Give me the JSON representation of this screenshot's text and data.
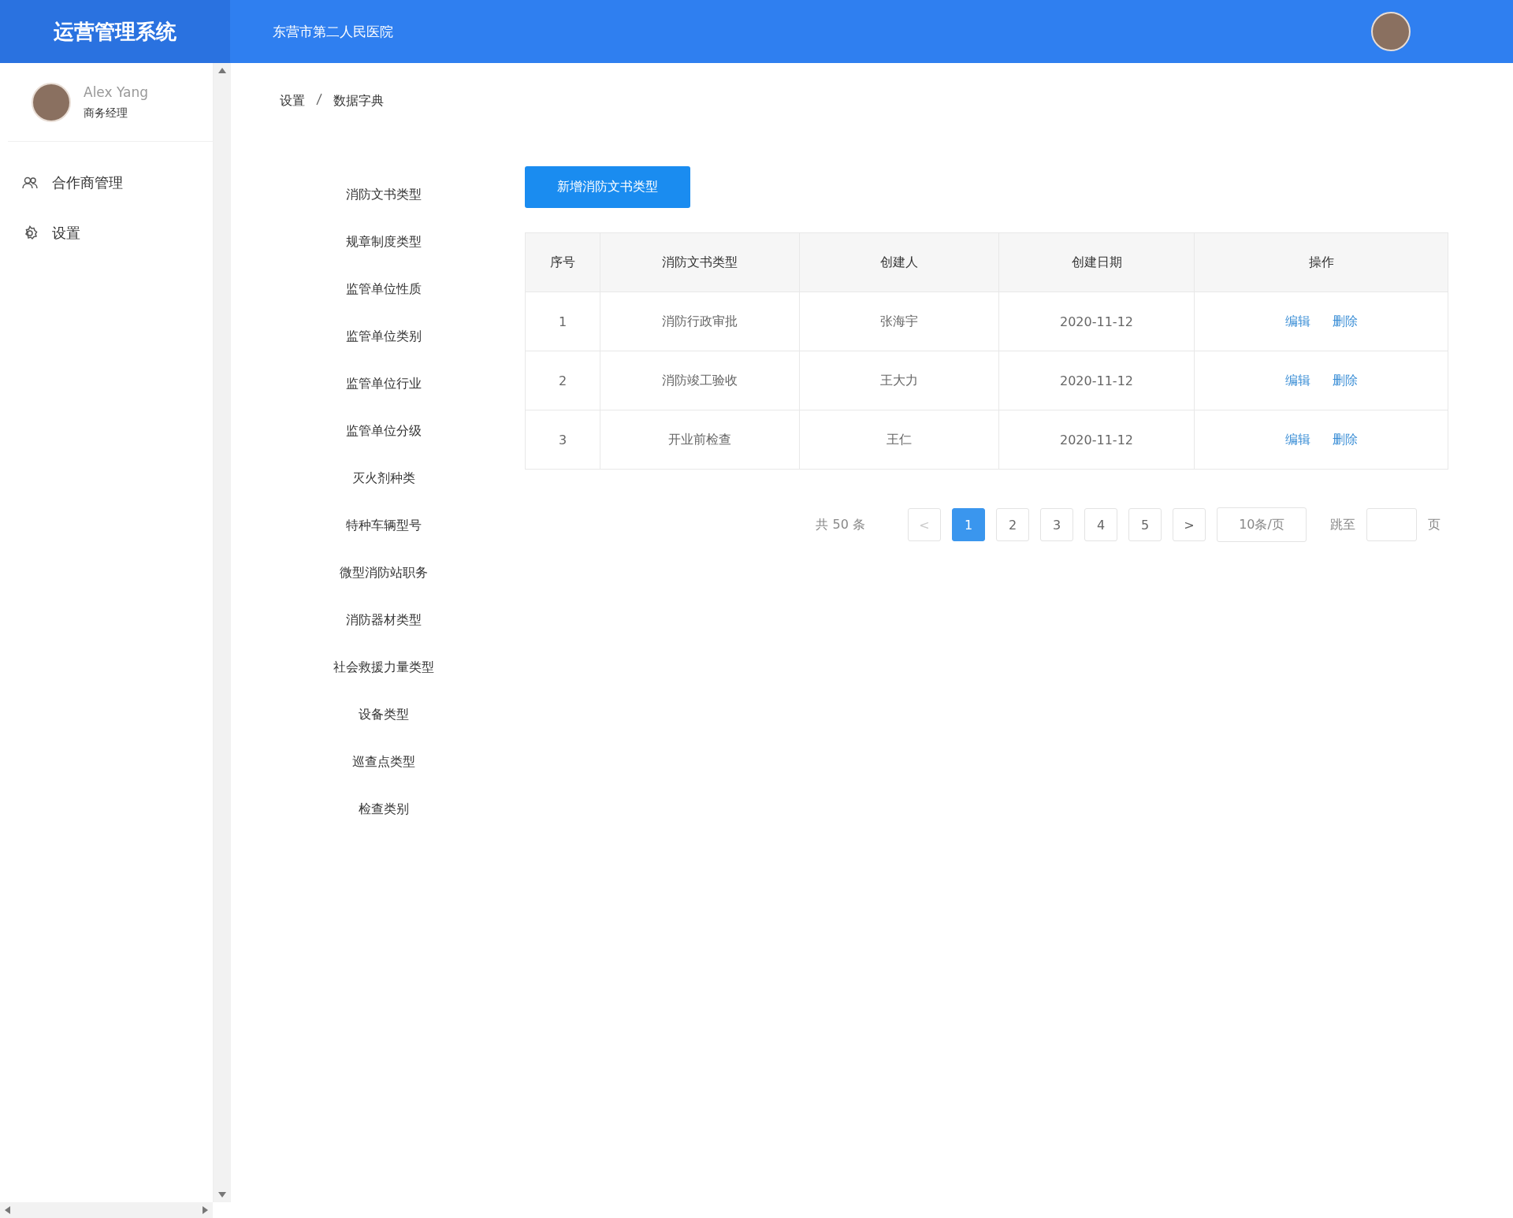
{
  "header": {
    "app_title": "运营管理系统",
    "organization": "东营市第二人民医院"
  },
  "sidebar": {
    "user": {
      "name": "Alex Yang",
      "role": "商务经理"
    },
    "items": [
      {
        "label": "合作商管理",
        "kind": "partners"
      },
      {
        "label": "设置",
        "kind": "settings"
      }
    ]
  },
  "breadcrumb": [
    "设置",
    "数据字典"
  ],
  "dictionary_menu": [
    "消防文书类型",
    "规章制度类型",
    "监管单位性质",
    "监管单位类别",
    "监管单位行业",
    "监管单位分级",
    "灭火剂种类",
    "特种车辆型号",
    "微型消防站职务",
    "消防器材类型",
    "社会救援力量类型",
    "设备类型",
    "巡查点类型",
    "检查类别"
  ],
  "add_button": "新增消防文书类型",
  "table": {
    "columns": [
      "序号",
      "消防文书类型",
      "创建人",
      "创建日期",
      "操作"
    ],
    "rows": [
      {
        "cells": [
          "1",
          "消防行政审批",
          "张海宇",
          "2020-11-12"
        ],
        "actions": [
          "编辑",
          "删除"
        ]
      },
      {
        "cells": [
          "2",
          "消防竣工验收",
          "王大力",
          "2020-11-12"
        ],
        "actions": [
          "编辑",
          "删除"
        ]
      },
      {
        "cells": [
          "3",
          "开业前检查",
          "王仁",
          "2020-11-12"
        ],
        "actions": [
          "编辑",
          "删除"
        ]
      }
    ]
  },
  "pagination": {
    "total": "共 50 条",
    "prev": {
      "label": "<",
      "disabled": true
    },
    "pages": [
      {
        "label": "1",
        "selected": true
      },
      {
        "label": "2",
        "selected": false
      },
      {
        "label": "3",
        "selected": false
      },
      {
        "label": "4",
        "selected": false
      },
      {
        "label": "5",
        "selected": false
      }
    ],
    "next": {
      "label": ">",
      "disabled": false
    },
    "page_size": "10条/页",
    "jump_label": "跳至",
    "jump_suffix": "页"
  }
}
